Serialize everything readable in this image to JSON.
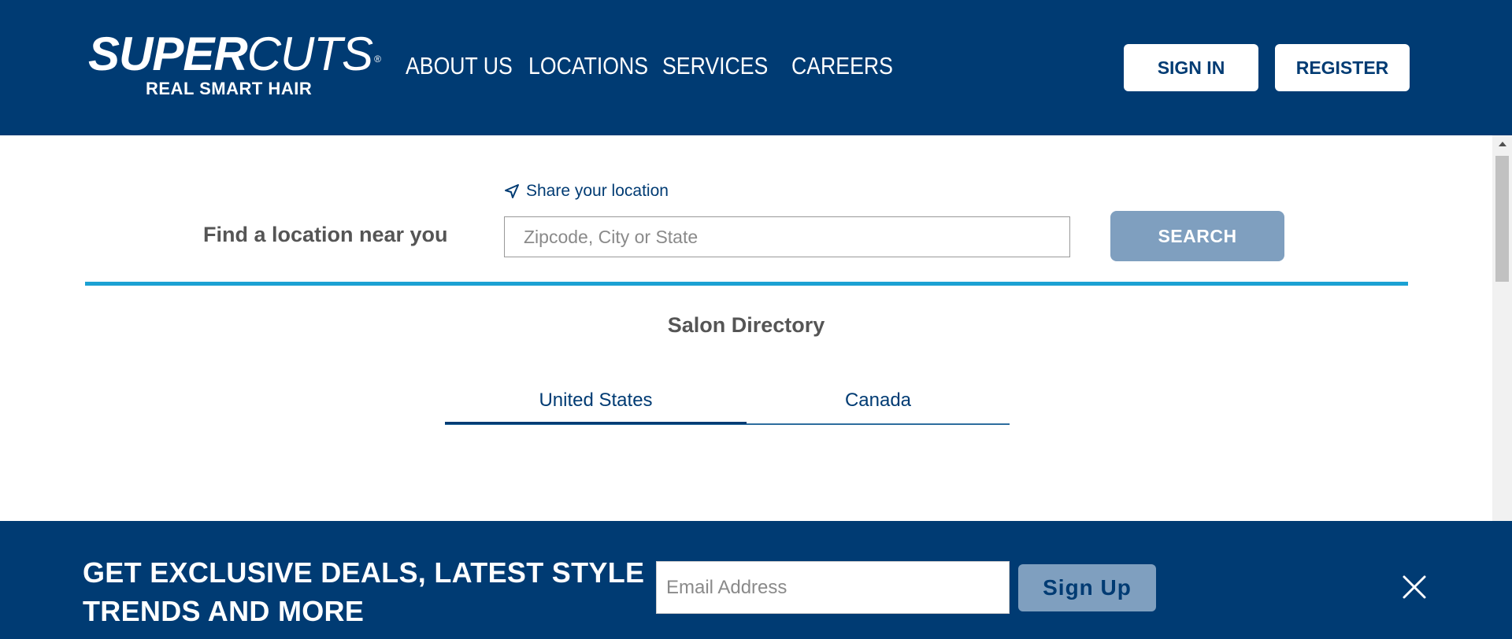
{
  "header": {
    "logo": {
      "brand_bold": "SUPER",
      "brand_light": "CUTS",
      "registered": "®",
      "tagline": "REAL SMART HAIR"
    },
    "nav": [
      {
        "label": "ABOUT US"
      },
      {
        "label": "LOCATIONS"
      },
      {
        "label": "SERVICES"
      },
      {
        "label": "CAREERS"
      }
    ],
    "sign_in_label": "SIGN IN",
    "register_label": "REGISTER"
  },
  "search": {
    "share_location_label": "Share your location",
    "find_label": "Find a location near you",
    "placeholder": "Zipcode, City or State",
    "value": "",
    "button_label": "SEARCH"
  },
  "directory": {
    "title": "Salon Directory",
    "tabs": [
      {
        "label": "United States",
        "active": true
      },
      {
        "label": "Canada",
        "active": false
      }
    ]
  },
  "banner": {
    "line1": "GET EXCLUSIVE DEALS, LATEST STYLE",
    "line2": "TRENDS AND MORE",
    "email_placeholder": "Email Address",
    "email_value": "",
    "signup_label": "Sign Up",
    "close_icon": "close-icon"
  },
  "colors": {
    "header_bg": "#003b73",
    "accent_line": "#1ba1d3",
    "button_muted": "#7f9fbf",
    "text_gray": "#555555"
  }
}
